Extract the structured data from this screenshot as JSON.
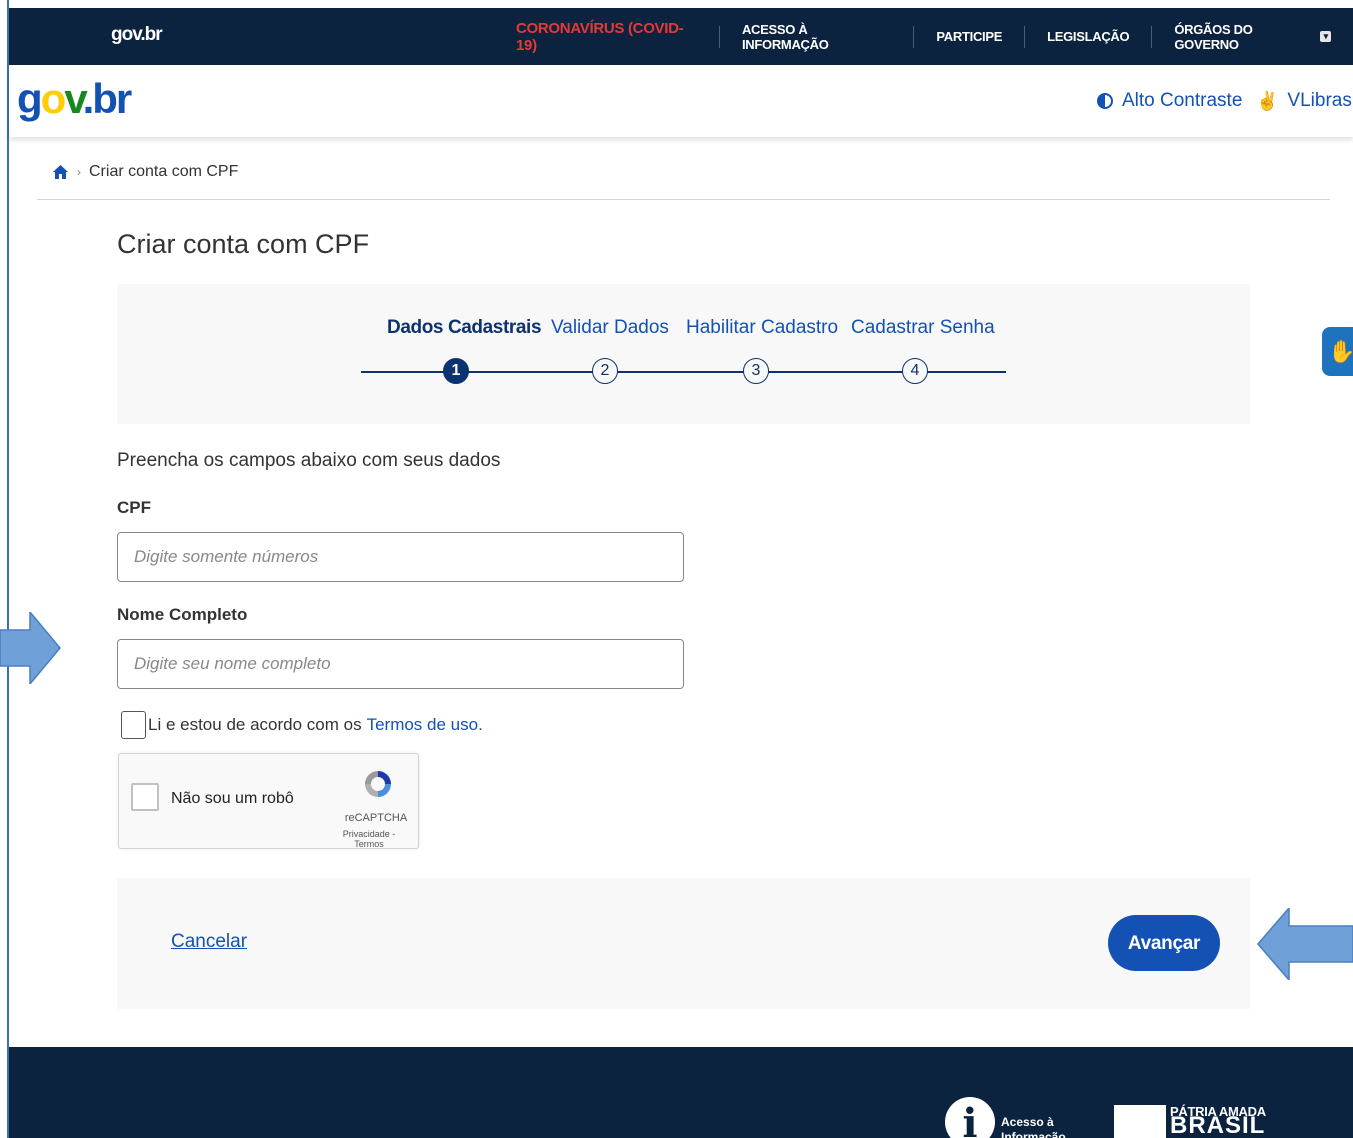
{
  "topbar": {
    "logo": "gov.br",
    "nav": [
      {
        "label": "CORONAVÍRUS (COVID-19)",
        "kind": "covid"
      },
      {
        "label": "ACESSO À INFORMAÇÃO"
      },
      {
        "label": "PARTICIPE"
      },
      {
        "label": "LEGISLAÇÃO"
      },
      {
        "label": "ÓRGÃOS DO GOVERNO",
        "has_dropdown": true
      }
    ]
  },
  "header": {
    "logo": "gov.br",
    "contrast_label": "Alto Contraste",
    "libras_label": "VLibras"
  },
  "breadcrumb": {
    "home_icon": "home-icon",
    "current": "Criar conta com CPF"
  },
  "main": {
    "title": "Criar conta com CPF",
    "steps": [
      {
        "label": "Dados Cadastrais",
        "number": "1",
        "active": true
      },
      {
        "label": "Validar Dados",
        "number": "2",
        "active": false
      },
      {
        "label": "Habilitar Cadastro",
        "number": "3",
        "active": false
      },
      {
        "label": "Cadastrar Senha",
        "number": "4",
        "active": false
      }
    ],
    "intro": "Preencha os campos abaixo com seus dados",
    "cpf": {
      "label": "CPF",
      "placeholder": "Digite somente números",
      "value": ""
    },
    "nome": {
      "label": "Nome Completo",
      "placeholder": "Digite seu nome completo",
      "value": ""
    },
    "terms": {
      "text": "Li e estou de acordo com os",
      "link": "Termos de uso.",
      "checked": false
    },
    "recaptcha": {
      "label": "Não sou um robô",
      "brand": "reCAPTCHA",
      "links": "Privacidade - Termos",
      "checked": false
    },
    "cancel_label": "Cancelar",
    "advance_label": "Avançar"
  },
  "footer": {
    "access_info": "Acesso à Informação",
    "patria_top": "PÁTRIA AMADA",
    "patria_bottom": "BRASIL"
  },
  "colors": {
    "topbar_bg": "#0c2340",
    "primary_blue": "#1351b4",
    "dark_blue": "#0c326f",
    "covid_red": "#e53935",
    "arrow_blue": "#6fa0d8"
  }
}
